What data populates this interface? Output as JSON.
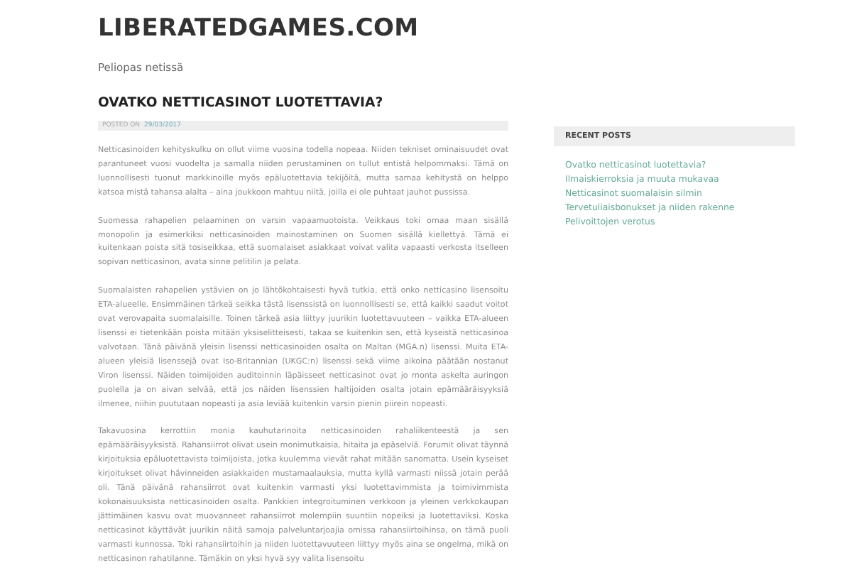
{
  "site": {
    "title": "LIBERATEDGAMES.COM",
    "tagline": "Peliopas netissä"
  },
  "post": {
    "title": "OVATKO NETTICASINOT LUOTETTAVIA?",
    "meta_label": "POSTED ON",
    "date": "29/03/2017",
    "paragraphs": [
      "Netticasinoiden kehityskulku on ollut viime vuosina todella nopeaa. Niiden tekniset ominaisuudet ovat parantuneet vuosi vuodelta ja samalla niiden perustaminen on tullut entistä helpommaksi. Tämä on luonnollisesti tuonut markkinoille myös epäluotettavia tekijöitä, mutta samaa kehitystä on helppo katsoa mistä tahansa alalta – aina joukkoon mahtuu niitä, joilla ei ole puhtaat jauhot pussissa.",
      "Suomessa rahapelien pelaaminen on varsin vapaamuotoista. Veikkaus toki omaa maan sisällä monopolin ja esimerkiksi netticasinoiden mainostaminen on Suomen sisällä kiellettyä. Tämä ei kuitenkaan poista sitä tosiseikkaa, että suomalaiset asiakkaat voivat valita vapaasti verkosta itselleen sopivan netticasinon, avata sinne pelitilin ja pelata.",
      "Suomalaisten rahapelien ystävien on jo lähtökohtaisesti hyvä tutkia, että onko netticasino lisensoitu ETA-alueelle. Ensimmäinen tärkeä seikka tästä lisenssistä on luonnollisesti se, että kaikki saadut voitot ovat verovapaita suomalaisille. Toinen tärkeä asia liittyy juurikin luotettavuuteen – vaikka ETA-alueen lisenssi ei tietenkään poista mitään yksiselitteisesti, takaa se kuitenkin sen, että kyseistä netticasinoa valvotaan. Tänä päivänä yleisin lisenssi netticasinoiden osalta on Maltan (MGA.n) lisenssi. Muita ETA-alueen yleisiä lisenssejä ovat Iso-Britannian (UKGC:n) lisenssi sekä viime aikoina päätään nostanut Viron lisenssi. Näiden toimijoiden auditoinnin läpäisseet netticasinot ovat jo monta askelta auringon puolella ja on aivan selvää, että jos näiden lisenssien haltijoiden osalta jotain epämääräisyyksiä ilmenee, niihin puututaan nopeasti ja asia leviää kuitenkin varsin pienin piirein nopeasti.",
      "Takavuosina kerrottiin monia kauhutarinoita netticasinoiden rahaliikenteestä ja sen epämääräisyyksistä. Rahansiirrot olivat usein monimutkaisia, hitaita ja epäselviä. Forumit olivat täynnä kirjoituksia epäluotettavista toimijoista, jotka kuulemma vievät rahat mitään sanomatta. Usein kyseiset kirjoitukset olivat hävinneiden asiakkaiden mustamaalauksia, mutta kyllä varmasti niissä jotain perää oli. Tänä päivänä rahansiirrot ovat kuitenkin varmasti yksi luotettavimmista ja toimivimmista kokonaisuuksista netticasinoiden osalta. Pankkien integroituminen verkkoon ja yleinen verkkokaupan jättimäinen kasvu ovat muovanneet rahansiirrot molempiin suuntiin nopeiksi ja luotettaviksi. Koska netticasinot käyttävät juurikin näitä samoja palveluntarjoajia omissa rahansiirtoihinsa, on tämä puoli varmasti kunnossa. Toki rahansiirtoihin ja niiden luotettavuuteen liittyy myös aina se ongelma, mikä on netticasinon rahatilanne. Tämäkin on yksi hyvä syy valita lisensoitu"
    ]
  },
  "sidebar": {
    "heading": "RECENT POSTS",
    "links": [
      "Ovatko netticasinot luotettavia?",
      "Ilmaiskierroksia ja muuta mukavaa",
      "Netticasinot suomalaisin silmin",
      "Tervetuliaisbonukset ja niiden rakenne",
      "Pelivoittojen verotus"
    ]
  }
}
